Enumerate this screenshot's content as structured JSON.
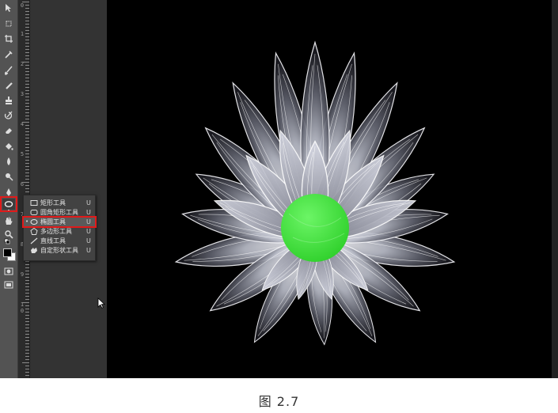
{
  "toolbar": {
    "tools": [
      "move",
      "marquee",
      "crop",
      "eyedropper",
      "brush",
      "spot-heal",
      "clone-stamp",
      "history-brush",
      "eraser",
      "paint-bucket",
      "blur",
      "dodge",
      "pen",
      "type",
      "path-select",
      "ellipse",
      "hand",
      "zoom",
      "swap-colors",
      "foreground-color",
      "quick-mask",
      "screen-mode"
    ],
    "selected": "ellipse"
  },
  "ruler": {
    "labels": [
      "0",
      "1",
      "2",
      "3",
      "4",
      "5",
      "6",
      "7",
      "8",
      "9",
      "1",
      "0"
    ]
  },
  "flyout": {
    "items": [
      {
        "label": "矩形工具",
        "shortcut": "U",
        "icon": "rectangle-icon",
        "active": false
      },
      {
        "label": "圆角矩形工具",
        "shortcut": "U",
        "icon": "rounded-rectangle-icon",
        "active": false
      },
      {
        "label": "椭圆工具",
        "shortcut": "U",
        "icon": "ellipse-icon",
        "active": true
      },
      {
        "label": "多边形工具",
        "shortcut": "U",
        "icon": "polygon-icon",
        "active": false
      },
      {
        "label": "直线工具",
        "shortcut": "U",
        "icon": "line-icon",
        "active": false
      },
      {
        "label": "自定形状工具",
        "shortcut": "U",
        "icon": "custom-shape-icon",
        "active": false
      }
    ]
  },
  "canvas": {
    "background": "#000000",
    "accent_circle": "#3ee63a"
  },
  "caption": "图  2.7"
}
